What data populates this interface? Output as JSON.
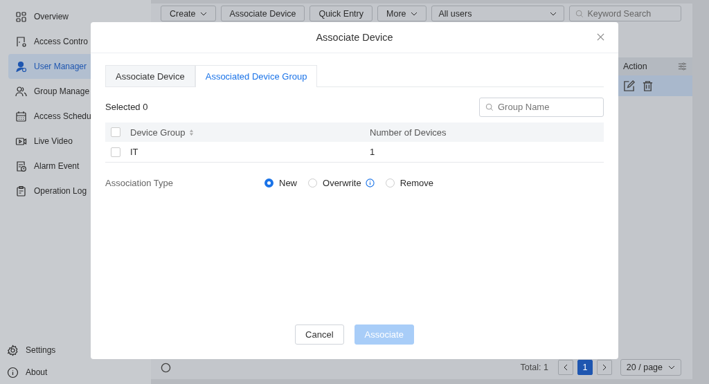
{
  "sidebar": {
    "items": [
      {
        "label": "Overview",
        "selected": false
      },
      {
        "label": "Access Contro",
        "selected": false
      },
      {
        "label": "User Manager",
        "selected": true
      },
      {
        "label": "Group Manage",
        "selected": false
      },
      {
        "label": "Access Schedu",
        "selected": false
      },
      {
        "label": "Live Video",
        "selected": false
      },
      {
        "label": "Alarm Event",
        "selected": false
      },
      {
        "label": "Operation Log",
        "selected": false
      }
    ],
    "footer_items": [
      {
        "label": "Settings"
      },
      {
        "label": "About"
      }
    ]
  },
  "toolbar": {
    "buttons": [
      {
        "label": "Create",
        "dropdown": true
      },
      {
        "label": "Associate Device",
        "dropdown": false
      },
      {
        "label": "Quick Entry",
        "dropdown": false
      },
      {
        "label": "More",
        "dropdown": true
      }
    ],
    "filter": {
      "value": "All users"
    },
    "search": {
      "placeholder": "Keyword Search"
    }
  },
  "table": {
    "columns": [
      {
        "label": "Action"
      }
    ]
  },
  "pagination": {
    "total": "Total: 1",
    "pages": [
      {
        "label": "1",
        "selected": true
      }
    ],
    "page_size": "20 / page"
  },
  "dialog": {
    "title": "Associate Device",
    "tabs": [
      {
        "label": "Associate Device",
        "selected": false
      },
      {
        "label": "Associated Device Group",
        "selected": true
      }
    ],
    "selected_count": "Selected 0",
    "search": {
      "placeholder": "Group Name"
    },
    "columns": [
      {
        "label": "Device Group",
        "sortable": true
      },
      {
        "label": "Number of Devices",
        "sortable": false
      }
    ],
    "header_checked": false,
    "rows": [
      {
        "checked": false,
        "cells": [
          "IT",
          "1"
        ]
      }
    ],
    "association_type": {
      "label": "Association Type",
      "options": [
        {
          "label": "New",
          "selected": true,
          "info": false
        },
        {
          "label": "Overwrite",
          "selected": false,
          "info": true
        },
        {
          "label": "Remove",
          "selected": false,
          "info": false
        }
      ]
    },
    "buttons": [
      {
        "label": "Cancel",
        "kind": "secondary",
        "disabled": false
      },
      {
        "label": "Associate",
        "kind": "primary",
        "disabled": true
      }
    ]
  }
}
